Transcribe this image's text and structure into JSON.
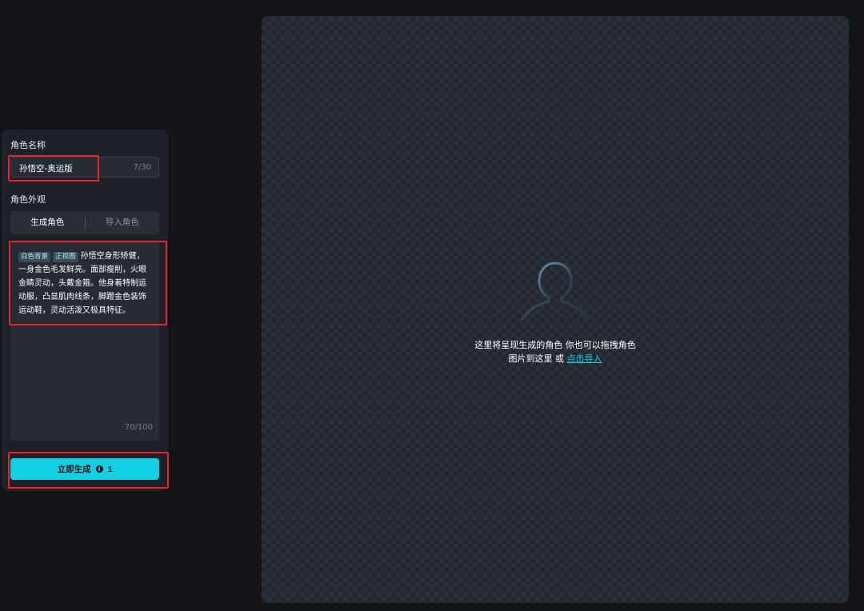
{
  "form": {
    "name_label": "角色名称",
    "name_value": "孙悟空-奥运版",
    "name_count": "7/30",
    "appearance_label": "角色外观",
    "tabs": [
      {
        "label": "生成角色",
        "active": true
      },
      {
        "label": "导入角色",
        "active": false
      }
    ],
    "tags": [
      "白色背景",
      "正视图"
    ],
    "description": "孙悟空身形矫健，一身金色毛发鲜亮。面部瘦削，火眼金睛灵动，头戴金箍。他身着特制运动服，凸显肌肉线条，脚蹬金色装饰运动鞋，灵动活泼又极具特征。",
    "description_count": "70/100",
    "generate_label": "立即生成",
    "generate_cost": "1"
  },
  "canvas": {
    "placeholder_icon": "user-silhouette-icon",
    "line1": "这里将呈现生成的角色 你也可以拖拽角色",
    "line2_prefix": "图片到这里 或 ",
    "import_link": "点击导入"
  },
  "colors": {
    "accent": "#13cfe4",
    "background": "#131417",
    "panel": "#1e2128",
    "annotation": "#e8242a"
  }
}
